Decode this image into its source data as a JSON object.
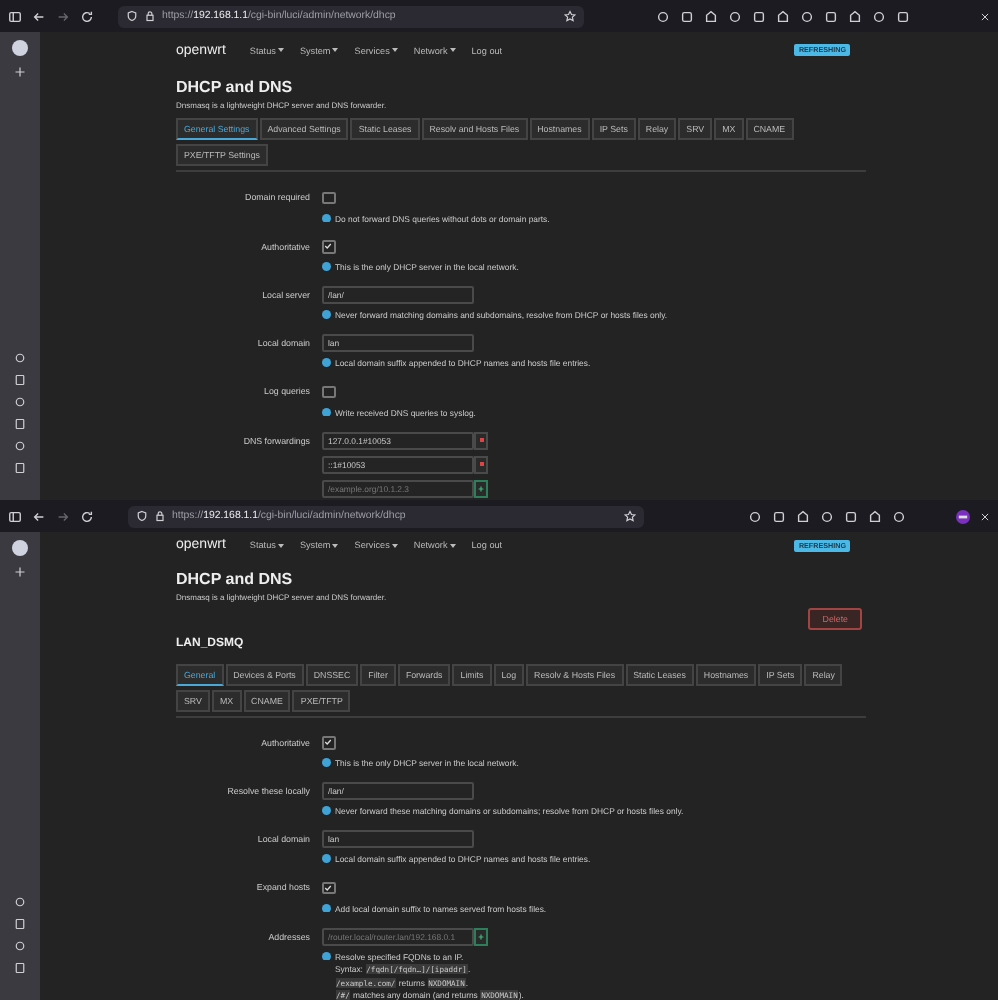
{
  "windows": [
    {
      "browser": {
        "url_scheme": "https://",
        "url_host": "192.168.1.1",
        "url_path": "/cgi-bin/luci/admin/network/dhcp",
        "profile_avatar": false
      },
      "nav": {
        "brand": "openwrt",
        "menu": [
          {
            "label": "Status",
            "dropdown": true
          },
          {
            "label": "System",
            "dropdown": true
          },
          {
            "label": "Services",
            "dropdown": true
          },
          {
            "label": "Network",
            "dropdown": true
          },
          {
            "label": "Log out",
            "dropdown": false
          }
        ],
        "badge": "REFRESHING"
      },
      "title": "DHCP and DNS",
      "description": "Dnsmasq is a lightweight DHCP server and DNS forwarder.",
      "tabs": [
        {
          "label": "General Settings",
          "selected": true
        },
        {
          "label": "Advanced Settings",
          "selected": false
        },
        {
          "label": "Static Leases",
          "selected": false
        },
        {
          "label": "Resolv and Hosts Files",
          "selected": false
        },
        {
          "label": "Hostnames",
          "selected": false
        },
        {
          "label": "IP Sets",
          "selected": false
        },
        {
          "label": "Relay",
          "selected": false
        },
        {
          "label": "SRV",
          "selected": false
        },
        {
          "label": "MX",
          "selected": false
        },
        {
          "label": "CNAME",
          "selected": false
        },
        {
          "label": "PXE/TFTP Settings",
          "selected": false
        }
      ],
      "fields": [
        {
          "kind": "checkbox",
          "label": "Domain required",
          "checked": false,
          "help": [
            [
              {
                "text": "Do not forward DNS queries without dots or domain parts.",
                "code": false
              }
            ]
          ]
        },
        {
          "kind": "checkbox",
          "label": "Authoritative",
          "checked": true,
          "help": [
            [
              {
                "text": "This is the only DHCP server in the local network.",
                "code": false
              }
            ]
          ]
        },
        {
          "kind": "text",
          "label": "Local server",
          "value": "/lan/",
          "help": [
            [
              {
                "text": "Never forward matching domains and subdomains, resolve from DHCP or hosts files only.",
                "code": false
              }
            ]
          ]
        },
        {
          "kind": "text",
          "label": "Local domain",
          "value": "lan",
          "help": [
            [
              {
                "text": "Local domain suffix appended to DHCP names and hosts file entries.",
                "code": false
              }
            ]
          ]
        },
        {
          "kind": "checkbox",
          "label": "Log queries",
          "checked": false,
          "help": [
            [
              {
                "text": "Write received DNS queries to syslog.",
                "code": false
              }
            ]
          ]
        },
        {
          "kind": "list",
          "label": "DNS forwardings",
          "entries": [
            {
              "value": "127.0.0.1#10053",
              "kind": "remove"
            },
            {
              "value": "::1#10053",
              "kind": "remove"
            },
            {
              "placeholder": "/example.org/10.1.2.3",
              "kind": "add"
            }
          ]
        }
      ]
    },
    {
      "browser": {
        "url_scheme": "https://",
        "url_host": "192.168.1.1",
        "url_path": "/cgi-bin/luci/admin/network/dhcp",
        "profile_avatar": true
      },
      "nav": {
        "brand": "openwrt",
        "menu": [
          {
            "label": "Status",
            "dropdown": true
          },
          {
            "label": "System",
            "dropdown": true
          },
          {
            "label": "Services",
            "dropdown": true
          },
          {
            "label": "Network",
            "dropdown": true
          },
          {
            "label": "Log out",
            "dropdown": false
          }
        ],
        "badge": "REFRESHING"
      },
      "title": "DHCP and DNS",
      "description": "Dnsmasq is a lightweight DHCP server and DNS forwarder.",
      "delete_button": "Delete",
      "section_title": "LAN_DSMQ",
      "tabs": [
        {
          "label": "General",
          "selected": true
        },
        {
          "label": "Devices & Ports",
          "selected": false
        },
        {
          "label": "DNSSEC",
          "selected": false
        },
        {
          "label": "Filter",
          "selected": false
        },
        {
          "label": "Forwards",
          "selected": false
        },
        {
          "label": "Limits",
          "selected": false
        },
        {
          "label": "Log",
          "selected": false
        },
        {
          "label": "Resolv & Hosts Files",
          "selected": false
        },
        {
          "label": "Static Leases",
          "selected": false
        },
        {
          "label": "Hostnames",
          "selected": false
        },
        {
          "label": "IP Sets",
          "selected": false
        },
        {
          "label": "Relay",
          "selected": false
        },
        {
          "label": "SRV",
          "selected": false
        },
        {
          "label": "MX",
          "selected": false
        },
        {
          "label": "CNAME",
          "selected": false
        },
        {
          "label": "PXE/TFTP",
          "selected": false
        }
      ],
      "fields": [
        {
          "kind": "checkbox",
          "label": "Authoritative",
          "checked": true,
          "help": [
            [
              {
                "text": "This is the only DHCP server in the local network.",
                "code": false
              }
            ]
          ]
        },
        {
          "kind": "text",
          "label": "Resolve these locally",
          "value": "/lan/",
          "help": [
            [
              {
                "text": "Never forward these matching domains or subdomains; resolve from DHCP or hosts files only.",
                "code": false
              }
            ]
          ]
        },
        {
          "kind": "text",
          "label": "Local domain",
          "value": "lan",
          "help": [
            [
              {
                "text": "Local domain suffix appended to DHCP names and hosts file entries.",
                "code": false
              }
            ]
          ]
        },
        {
          "kind": "checkbox",
          "label": "Expand hosts",
          "checked": true,
          "help": [
            [
              {
                "text": "Add local domain suffix to names served from hosts files.",
                "code": false
              }
            ]
          ]
        },
        {
          "kind": "list",
          "label": "Addresses",
          "entries": [
            {
              "placeholder": "/router.local/router.lan/192.168.0.1",
              "kind": "add"
            }
          ],
          "help": [
            [
              {
                "text": "Resolve specified FQDNs to an IP.",
                "code": false
              }
            ],
            [
              {
                "text": "Syntax: ",
                "code": false
              },
              {
                "text": "/fqdn[/fqdn…]/[ipaddr]",
                "code": true
              },
              {
                "text": ".",
                "code": false
              }
            ],
            [
              {
                "text": "/example.com/",
                "code": true
              },
              {
                "text": " returns ",
                "code": false
              },
              {
                "text": "NXDOMAIN",
                "code": true
              },
              {
                "text": ".",
                "code": false
              }
            ],
            [
              {
                "text": "/#/",
                "code": true
              },
              {
                "text": " matches any domain (and returns ",
                "code": false
              },
              {
                "text": "NXDOMAIN",
                "code": true
              },
              {
                "text": ").",
                "code": false
              }
            ]
          ]
        }
      ]
    }
  ]
}
